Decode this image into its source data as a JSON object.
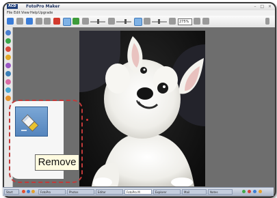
{
  "app": {
    "logo": "ACD",
    "title": "FotoPro Maker"
  },
  "window_controls": {
    "minimize": "–",
    "maximize": "□",
    "close": "×"
  },
  "menu": [
    "File",
    "Edit",
    "View",
    "Help",
    "Upgrade"
  ],
  "toolbar": {
    "zoom_value": "275%"
  },
  "tooltip": {
    "label": "Remove"
  },
  "taskbar": {
    "tasks": [
      "Start",
      "FotoPro",
      "Photos",
      "Editor",
      "FotoPro M",
      "Explorer",
      "Mail",
      "Notes"
    ]
  },
  "colors": {
    "accent": "#3b7dd8",
    "callout_border": "#c33a3a",
    "tooltip_bg": "#fffbe0"
  },
  "icons": {
    "tool_icon": "eraser-icon"
  }
}
